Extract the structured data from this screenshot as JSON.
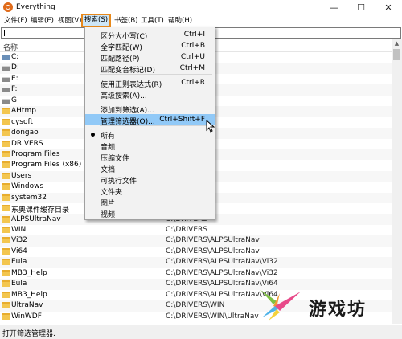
{
  "window": {
    "title": "Everything",
    "minimize": "—",
    "maximize": "☐",
    "close": "✕"
  },
  "menu": [
    "文件(F)",
    "编辑(E)",
    "视图(V)",
    "搜索(S)",
    "书签(B)",
    "工具(T)",
    "帮助(H)"
  ],
  "search": {
    "value": ""
  },
  "columns": {
    "name": "名称"
  },
  "dropdown": {
    "items": [
      {
        "label": "区分大小写(C)",
        "shortcut": "Ctrl+I"
      },
      {
        "label": "全字匹配(W)",
        "shortcut": "Ctrl+B"
      },
      {
        "label": "匹配路径(P)",
        "shortcut": "Ctrl+U"
      },
      {
        "label": "匹配变音标记(D)",
        "shortcut": "Ctrl+M"
      },
      {
        "label": "使用正则表达式(R)",
        "shortcut": "Ctrl+R"
      },
      {
        "label": "高级搜索(A)...",
        "shortcut": ""
      },
      {
        "label": "添加到筛选(A)...",
        "shortcut": ""
      },
      {
        "label": "管理筛选器(O)...",
        "shortcut": "Ctrl+Shift+F"
      },
      {
        "label": "所有",
        "shortcut": ""
      },
      {
        "label": "音频",
        "shortcut": ""
      },
      {
        "label": "压缩文件",
        "shortcut": ""
      },
      {
        "label": "文档",
        "shortcut": ""
      },
      {
        "label": "可执行文件",
        "shortcut": ""
      },
      {
        "label": "文件夹",
        "shortcut": ""
      },
      {
        "label": "图片",
        "shortcut": ""
      },
      {
        "label": "视频",
        "shortcut": ""
      }
    ]
  },
  "rows": [
    {
      "name": "C:",
      "path": "",
      "icon": "drive-system-icon"
    },
    {
      "name": "D:",
      "path": "",
      "icon": "drive-icon"
    },
    {
      "name": "E:",
      "path": "",
      "icon": "drive-icon"
    },
    {
      "name": "F:",
      "path": "",
      "icon": "drive-icon"
    },
    {
      "name": "G:",
      "path": "",
      "icon": "drive-icon"
    },
    {
      "name": "AHtmp",
      "path": "",
      "icon": "folder-icon"
    },
    {
      "name": "cysoft",
      "path": "",
      "icon": "folder-icon"
    },
    {
      "name": "dongao",
      "path": "",
      "icon": "folder-icon"
    },
    {
      "name": "DRIVERS",
      "path": "",
      "icon": "folder-icon"
    },
    {
      "name": "Program Files",
      "path": "",
      "icon": "folder-icon"
    },
    {
      "name": "Program Files (x86)",
      "path": "",
      "icon": "folder-icon"
    },
    {
      "name": "Users",
      "path": "",
      "icon": "folder-icon"
    },
    {
      "name": "Windows",
      "path": "",
      "icon": "folder-icon"
    },
    {
      "name": "system32",
      "path": "",
      "icon": "folder-icon"
    },
    {
      "name": "东奥课件缓存目录",
      "path": "",
      "icon": "folder-icon"
    },
    {
      "name": "ALPSUltraNav",
      "path": "C:\\DRIVERS",
      "icon": "folder-icon"
    },
    {
      "name": "WIN",
      "path": "C:\\DRIVERS",
      "icon": "folder-icon"
    },
    {
      "name": "Vi32",
      "path": "C:\\DRIVERS\\ALPSUltraNav",
      "icon": "folder-icon"
    },
    {
      "name": "Vi64",
      "path": "C:\\DRIVERS\\ALPSUltraNav",
      "icon": "folder-icon"
    },
    {
      "name": "Eula",
      "path": "C:\\DRIVERS\\ALPSUltraNav\\Vi32",
      "icon": "folder-icon"
    },
    {
      "name": "MB3_Help",
      "path": "C:\\DRIVERS\\ALPSUltraNav\\Vi32",
      "icon": "folder-icon"
    },
    {
      "name": "Eula",
      "path": "C:\\DRIVERS\\ALPSUltraNav\\Vi64",
      "icon": "folder-icon"
    },
    {
      "name": "MB3_Help",
      "path": "C:\\DRIVERS\\ALPSUltraNav\\Vi64",
      "icon": "folder-icon"
    },
    {
      "name": "UltraNav",
      "path": "C:\\DRIVERS\\WIN",
      "icon": "folder-icon"
    },
    {
      "name": "WinWDF",
      "path": "C:\\DRIVERS\\WIN\\UltraNav",
      "icon": "folder-icon"
    }
  ],
  "status": {
    "text": "打开筛选管理器."
  },
  "watermark": {
    "text": "游戏坊"
  }
}
